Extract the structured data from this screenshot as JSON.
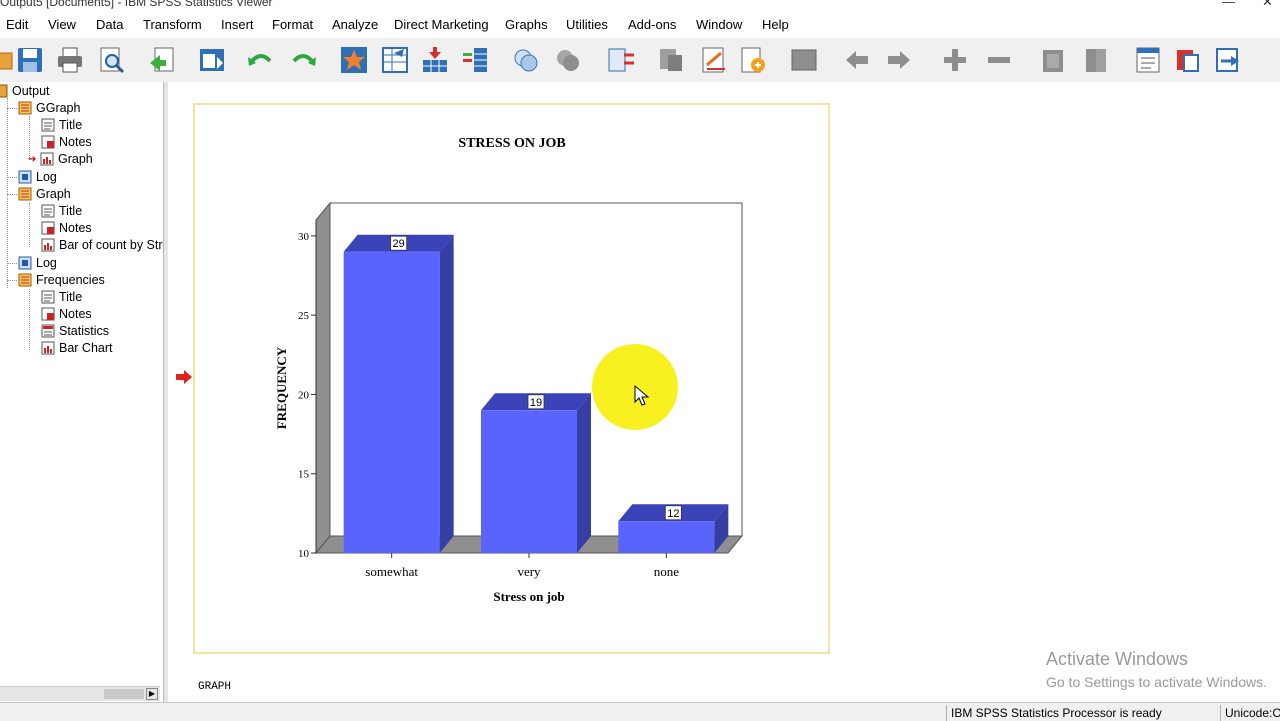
{
  "window": {
    "title": "Output5 [Document5] - IBM SPSS Statistics Viewer"
  },
  "menu": [
    "Edit",
    "View",
    "Data",
    "Transform",
    "Insert",
    "Format",
    "Analyze",
    "Direct Marketing",
    "Graphs",
    "Utilities",
    "Add-ons",
    "Window",
    "Help"
  ],
  "toolbar_icons": [
    "open-icon",
    "save-icon",
    "print-icon",
    "print-preview-icon",
    "export-icon",
    "recall-dialog-icon",
    "undo-icon",
    "redo-icon",
    "goto-case-icon",
    "goto-variable-icon",
    "insert-data-icon",
    "variables-icon",
    "select-cases-icon",
    "value-labels-icon",
    "split-file-icon",
    "weight-cases-icon",
    "run-script-icon",
    "designate-window-icon",
    "promote-icon",
    "demote-icon",
    "expand-icon",
    "collapse-icon",
    "show-icon",
    "hide-icon",
    "insert-heading-icon",
    "insert-title-icon",
    "insert-text-icon"
  ],
  "outline": {
    "root": "Output",
    "nodes": [
      {
        "label": "GGraph",
        "icon": "ggraph-icon"
      },
      {
        "label": "Title",
        "icon": "title-icon"
      },
      {
        "label": "Notes",
        "icon": "notes-icon"
      },
      {
        "label": "Graph",
        "icon": "graph-icon"
      },
      {
        "label": "Log",
        "icon": "log-icon"
      },
      {
        "label": "Graph",
        "icon": "ggraph-icon"
      },
      {
        "label": "Title",
        "icon": "title-icon"
      },
      {
        "label": "Notes",
        "icon": "notes-icon"
      },
      {
        "label": "Bar of count by Str",
        "icon": "graph-icon"
      },
      {
        "label": "Log",
        "icon": "log-icon"
      },
      {
        "label": "Frequencies",
        "icon": "ggraph-icon"
      },
      {
        "label": "Title",
        "icon": "title-icon"
      },
      {
        "label": "Notes",
        "icon": "notes-icon"
      },
      {
        "label": "Statistics",
        "icon": "statistics-icon"
      },
      {
        "label": "Bar Chart",
        "icon": "graph-icon"
      }
    ]
  },
  "content": {
    "command_label": "GRAPH"
  },
  "chart_data": {
    "type": "bar",
    "title": "STRESS ON JOB",
    "xlabel": "Stress on job",
    "ylabel": "FREQUENCY",
    "categories": [
      "somewhat",
      "very",
      "none"
    ],
    "values": [
      29,
      19,
      12
    ],
    "data_labels": [
      "29",
      "19",
      "12"
    ],
    "ylim": [
      10,
      31
    ],
    "yticks": [
      10,
      15,
      20,
      25,
      30
    ],
    "three_d": true,
    "bar_color": "#5a64fd",
    "bar_top_color": "#3a43b8",
    "bar_side_color": "#343ea3"
  },
  "watermark": {
    "line1": "Activate Windows",
    "line2": "Go to Settings to activate Windows."
  },
  "status": {
    "processor": "IBM SPSS Statistics Processor is ready",
    "encoding": "Unicode:ON"
  },
  "colors": {
    "accent_highlight": "#f7ef07",
    "frame_border": "#f3e3a3"
  }
}
